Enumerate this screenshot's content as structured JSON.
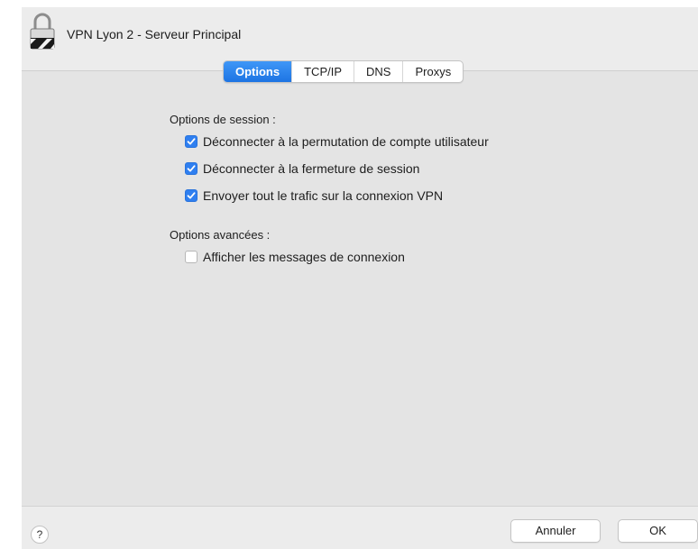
{
  "window": {
    "title": "VPN Lyon 2 - Serveur Principal"
  },
  "tabs": [
    {
      "label": "Options",
      "active": true
    },
    {
      "label": "TCP/IP",
      "active": false
    },
    {
      "label": "DNS",
      "active": false
    },
    {
      "label": "Proxys",
      "active": false
    }
  ],
  "session_options": {
    "label": "Options de session :",
    "items": [
      {
        "label": "Déconnecter à la permutation de compte utilisateur",
        "checked": true
      },
      {
        "label": "Déconnecter à la fermeture de session",
        "checked": true
      },
      {
        "label": "Envoyer tout le trafic sur la connexion VPN",
        "checked": true
      }
    ]
  },
  "advanced_options": {
    "label": "Options avancées :",
    "items": [
      {
        "label": "Afficher les messages de connexion",
        "checked": false
      }
    ]
  },
  "footer": {
    "help_label": "?",
    "cancel_label": "Annuler",
    "ok_label": "OK"
  },
  "colors": {
    "accent": "#2f7ff0",
    "panel": "#e4e4e4"
  },
  "icons": {
    "header": "vpn-lock-icon",
    "checkmark": "checkmark-icon"
  }
}
